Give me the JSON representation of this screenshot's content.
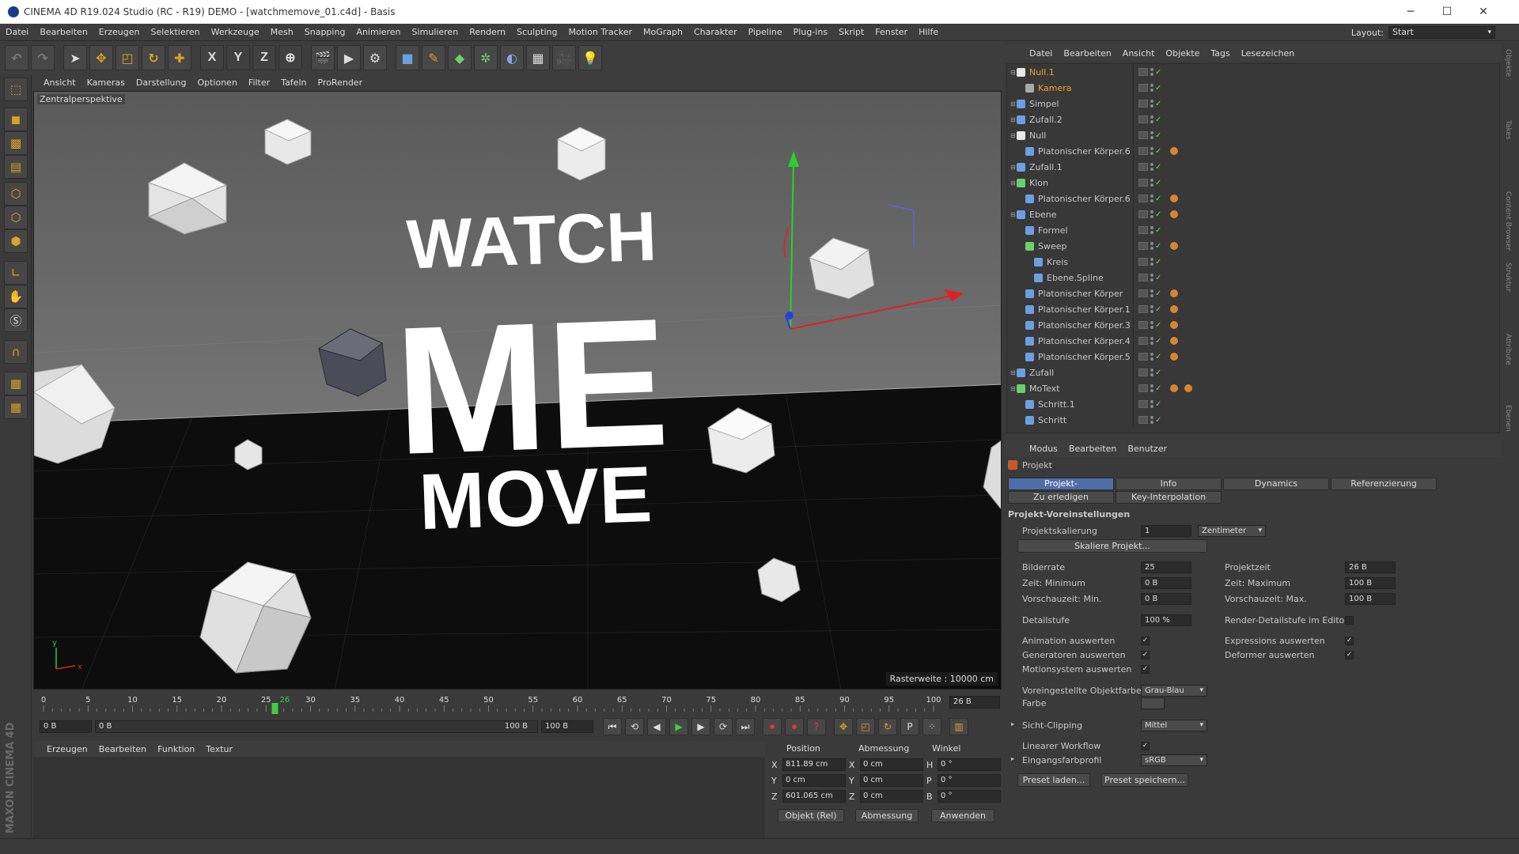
{
  "window": {
    "title": "CINEMA 4D R19.024 Studio (RC - R19) DEMO - [watchmemove_01.c4d] - Basis"
  },
  "menu": [
    "Datei",
    "Bearbeiten",
    "Erzeugen",
    "Selektieren",
    "Werkzeuge",
    "Mesh",
    "Snapping",
    "Animieren",
    "Simulieren",
    "Rendern",
    "Sculpting",
    "Motion Tracker",
    "MoGraph",
    "Charakter",
    "Pipeline",
    "Plug-ins",
    "Skript",
    "Fenster",
    "Hilfe"
  ],
  "layout": {
    "label": "Layout:",
    "value": "Start"
  },
  "toolbar": {
    "axis_x": "X",
    "axis_y": "Y",
    "axis_z": "Z"
  },
  "view_menu": [
    "Ansicht",
    "Kameras",
    "Darstellung",
    "Optionen",
    "Filter",
    "Tafeln",
    "ProRender"
  ],
  "viewport": {
    "label": "Zentralperspektive",
    "raster": "Rasterweite : 10000 cm",
    "text_lines": [
      "WATCH",
      "ME",
      "MOVE"
    ],
    "axis_y": "y",
    "axis_x": "x"
  },
  "timeline": {
    "ticks": [
      "0",
      "5",
      "10",
      "15",
      "20",
      "25",
      "30",
      "35",
      "40",
      "45",
      "50",
      "55",
      "60",
      "65",
      "70",
      "75",
      "80",
      "85",
      "90",
      "95",
      "100"
    ],
    "current": "26",
    "current_field": "26 B"
  },
  "time_controls": {
    "start": "0 B",
    "range_start": "0 B",
    "range_end": "100 B",
    "end": "100 B"
  },
  "material_menu": [
    "Erzeugen",
    "Bearbeiten",
    "Funktion",
    "Textur"
  ],
  "coords": {
    "headers": [
      "Position",
      "Abmessung",
      "Winkel"
    ],
    "rows": [
      {
        "a": "X",
        "pos": "811.89 cm",
        "b": "X",
        "size": "0 cm",
        "c": "H",
        "rot": "0 °"
      },
      {
        "a": "Y",
        "pos": "0 cm",
        "b": "Y",
        "size": "0 cm",
        "c": "P",
        "rot": "0 °"
      },
      {
        "a": "Z",
        "pos": "601.065 cm",
        "b": "Z",
        "size": "0 cm",
        "c": "B",
        "rot": "0 °"
      }
    ],
    "mode": "Objekt (Rel)",
    "size_mode": "Abmessung",
    "apply": "Anwenden"
  },
  "object_menu": [
    "Datei",
    "Bearbeiten",
    "Ansicht",
    "Objekte",
    "Tags",
    "Lesezeichen"
  ],
  "objects": [
    {
      "name": "Null.1",
      "level": 0,
      "color": "#e8e8e8",
      "state": "sel",
      "tags": 0
    },
    {
      "name": "Kamera",
      "level": 1,
      "color": "#aaaaaa",
      "state": "act",
      "tags": 0
    },
    {
      "name": "Simpel",
      "level": 0,
      "color": "#6aa0e0",
      "state": "",
      "tags": 0
    },
    {
      "name": "Zufall.2",
      "level": 0,
      "color": "#6aa0e0",
      "state": "",
      "tags": 0
    },
    {
      "name": "Null",
      "level": 0,
      "color": "#e8e8e8",
      "state": "",
      "tags": 0
    },
    {
      "name": "Platonischer Körper.6",
      "level": 1,
      "color": "#6aa0e0",
      "state": "",
      "tags": 1
    },
    {
      "name": "Zufall.1",
      "level": 0,
      "color": "#6aa0e0",
      "state": "",
      "tags": 0
    },
    {
      "name": "Klon",
      "level": 0,
      "color": "#6ad06a",
      "state": "",
      "tags": 0
    },
    {
      "name": "Platonischer Körper.6",
      "level": 1,
      "color": "#6aa0e0",
      "state": "",
      "tags": 1
    },
    {
      "name": "Ebene",
      "level": 0,
      "color": "#6aa0e0",
      "state": "",
      "tags": 1
    },
    {
      "name": "Formel",
      "level": 1,
      "color": "#6aa0e0",
      "state": "",
      "tags": 0
    },
    {
      "name": "Sweep",
      "level": 1,
      "color": "#6ad06a",
      "state": "",
      "tags": 1
    },
    {
      "name": "Kreis",
      "level": 2,
      "color": "#6aa0e0",
      "state": "",
      "tags": 0
    },
    {
      "name": "Ebene.Spline",
      "level": 2,
      "color": "#6aa0e0",
      "state": "",
      "tags": 0
    },
    {
      "name": "Platonischer Körper",
      "level": 1,
      "color": "#6aa0e0",
      "state": "",
      "tags": 1
    },
    {
      "name": "Platonischer Körper.1",
      "level": 1,
      "color": "#6aa0e0",
      "state": "",
      "tags": 1
    },
    {
      "name": "Platonischer Körper.3",
      "level": 1,
      "color": "#6aa0e0",
      "state": "",
      "tags": 1
    },
    {
      "name": "Platonischer Körper.4",
      "level": 1,
      "color": "#6aa0e0",
      "state": "",
      "tags": 1
    },
    {
      "name": "Platonischer Körper.5",
      "level": 1,
      "color": "#6aa0e0",
      "state": "",
      "tags": 1
    },
    {
      "name": "Zufall",
      "level": 0,
      "color": "#6aa0e0",
      "state": "",
      "tags": 0
    },
    {
      "name": "MoText",
      "level": 0,
      "color": "#6ad06a",
      "state": "",
      "tags": 2
    },
    {
      "name": "Schritt.1",
      "level": 1,
      "color": "#6aa0e0",
      "state": "",
      "tags": 0
    },
    {
      "name": "Schritt",
      "level": 1,
      "color": "#6aa0e0",
      "state": "",
      "tags": 0
    }
  ],
  "attr_menu": [
    "Modus",
    "Bearbeiten",
    "Benutzer"
  ],
  "attr": {
    "object": "Projekt",
    "tabs_row1": [
      "Projekt-Voreinstellungen",
      "Info",
      "Dynamics",
      "Referenzierung"
    ],
    "tabs_row2": [
      "Zu erledigen",
      "Key-Interpolation"
    ],
    "section": "Projekt-Voreinstellungen",
    "scale_label": "Projektskalierung",
    "scale_value": "1",
    "scale_unit": "Zentimeter",
    "scale_button": "Skaliere Projekt...",
    "fps_label": "Bilderrate",
    "fps": "25",
    "projtime_label": "Projektzeit",
    "projtime": "26 B",
    "tmin_label": "Zeit: Minimum",
    "tmin": "0 B",
    "tmax_label": "Zeit: Maximum",
    "tmax": "100 B",
    "pmin_label": "Vorschauzeit: Min.",
    "pmin": "0 B",
    "pmax_label": "Vorschauzeit: Max.",
    "pmax": "100 B",
    "detail_label": "Detailstufe",
    "detail": "100 %",
    "render_detail_label": "Render-Detailstufe im Editor",
    "anim_label": "Animation auswerten",
    "expr_label": "Expressions auswerten",
    "gen_label": "Generatoren auswerten",
    "deform_label": "Deformer auswerten",
    "motion_label": "Motionsystem auswerten",
    "objcolor_label": "Voreingestellte Objektfarbe",
    "objcolor": "Grau-Blau",
    "color_label": "Farbe",
    "clip_label": "Sicht-Clipping",
    "clip": "Mittel",
    "linear_label": "Linearer Workflow",
    "profile_label": "Eingangsfarbprofil",
    "profile": "sRGB",
    "preset_load": "Preset laden...",
    "preset_save": "Preset speichern..."
  },
  "right_tabs": [
    "Objekte",
    "Takes",
    "Content Browser",
    "Struktur",
    "Attribute",
    "Ebenen"
  ],
  "brand": "MAXON CINEMA 4D"
}
